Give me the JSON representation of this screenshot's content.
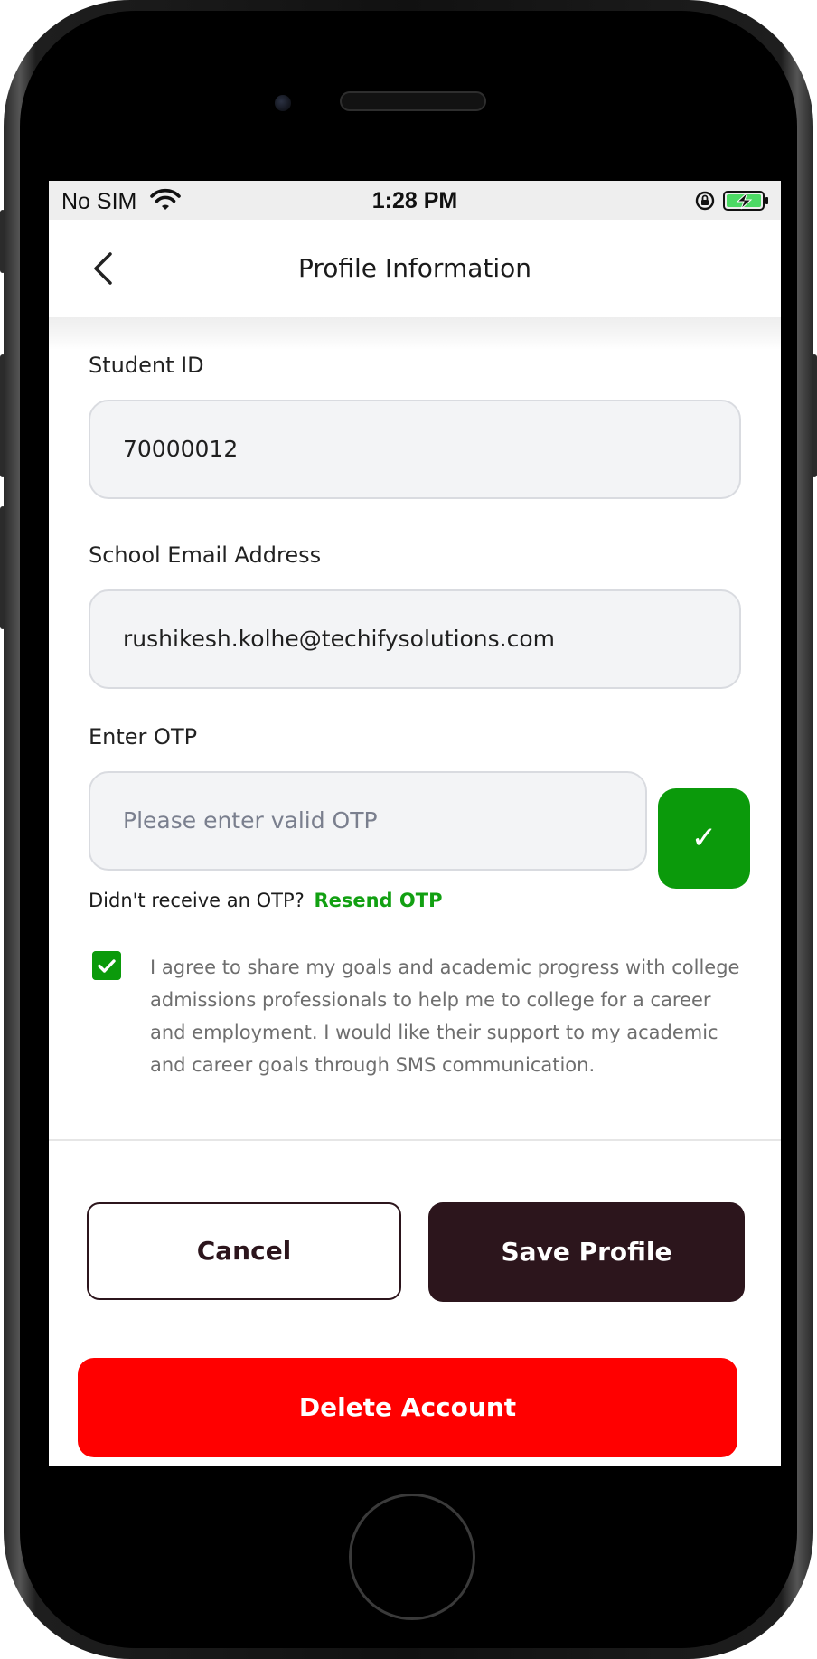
{
  "status_bar": {
    "carrier": "No SIM",
    "time": "1:28 PM",
    "wifi_icon": "wifi-icon",
    "lock_icon": "rotation-lock-icon",
    "battery_icon": "battery-charging-icon"
  },
  "header": {
    "title": "Profile Information",
    "back_icon": "chevron-left-icon"
  },
  "form": {
    "student_id": {
      "label": "Student ID",
      "value": "70000012"
    },
    "email": {
      "label": "School Email Address",
      "value": "rushikesh.kolhe@techifysolutions.com"
    },
    "otp": {
      "label": "Enter OTP",
      "placeholder": "Please enter valid OTP",
      "verify_symbol": "✓"
    },
    "resend_prompt": "Didn't receive an OTP?",
    "resend_link": "Resend OTP",
    "consent_checked": true,
    "consent_text": "I agree to share my goals and academic progress with college admissions professionals to help me to college for a career and employment. I would like their support to my academic and career goals through SMS communication."
  },
  "actions": {
    "cancel": "Cancel",
    "save": "Save Profile",
    "delete": "Delete Account"
  },
  "colors": {
    "primary_dark": "#2c151c",
    "accent_green": "#0b9a0b",
    "danger_red": "#ff0000"
  }
}
